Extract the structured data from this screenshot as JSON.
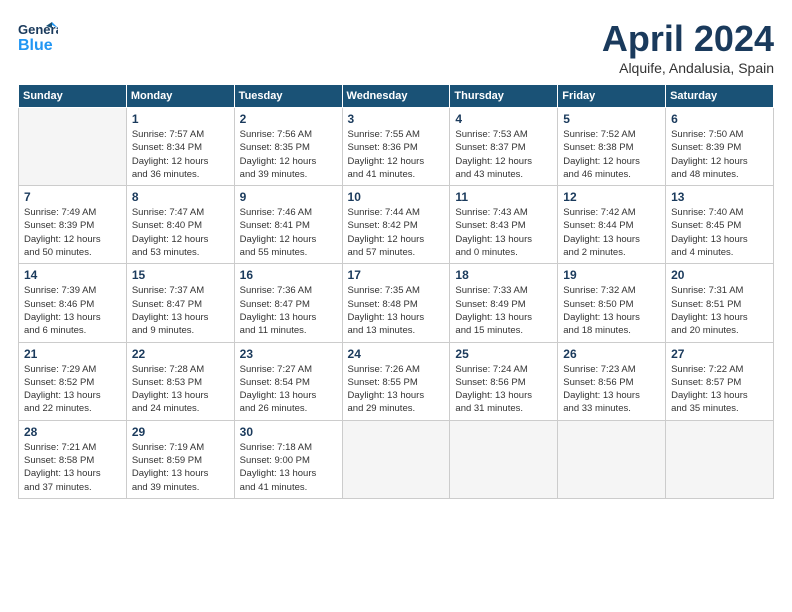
{
  "header": {
    "logo_general": "General",
    "logo_blue": "Blue",
    "title": "April 2024",
    "location": "Alquife, Andalusia, Spain"
  },
  "weekdays": [
    "Sunday",
    "Monday",
    "Tuesday",
    "Wednesday",
    "Thursday",
    "Friday",
    "Saturday"
  ],
  "weeks": [
    [
      {
        "num": "",
        "info": ""
      },
      {
        "num": "1",
        "info": "Sunrise: 7:57 AM\nSunset: 8:34 PM\nDaylight: 12 hours\nand 36 minutes."
      },
      {
        "num": "2",
        "info": "Sunrise: 7:56 AM\nSunset: 8:35 PM\nDaylight: 12 hours\nand 39 minutes."
      },
      {
        "num": "3",
        "info": "Sunrise: 7:55 AM\nSunset: 8:36 PM\nDaylight: 12 hours\nand 41 minutes."
      },
      {
        "num": "4",
        "info": "Sunrise: 7:53 AM\nSunset: 8:37 PM\nDaylight: 12 hours\nand 43 minutes."
      },
      {
        "num": "5",
        "info": "Sunrise: 7:52 AM\nSunset: 8:38 PM\nDaylight: 12 hours\nand 46 minutes."
      },
      {
        "num": "6",
        "info": "Sunrise: 7:50 AM\nSunset: 8:39 PM\nDaylight: 12 hours\nand 48 minutes."
      }
    ],
    [
      {
        "num": "7",
        "info": "Sunrise: 7:49 AM\nSunset: 8:39 PM\nDaylight: 12 hours\nand 50 minutes."
      },
      {
        "num": "8",
        "info": "Sunrise: 7:47 AM\nSunset: 8:40 PM\nDaylight: 12 hours\nand 53 minutes."
      },
      {
        "num": "9",
        "info": "Sunrise: 7:46 AM\nSunset: 8:41 PM\nDaylight: 12 hours\nand 55 minutes."
      },
      {
        "num": "10",
        "info": "Sunrise: 7:44 AM\nSunset: 8:42 PM\nDaylight: 12 hours\nand 57 minutes."
      },
      {
        "num": "11",
        "info": "Sunrise: 7:43 AM\nSunset: 8:43 PM\nDaylight: 13 hours\nand 0 minutes."
      },
      {
        "num": "12",
        "info": "Sunrise: 7:42 AM\nSunset: 8:44 PM\nDaylight: 13 hours\nand 2 minutes."
      },
      {
        "num": "13",
        "info": "Sunrise: 7:40 AM\nSunset: 8:45 PM\nDaylight: 13 hours\nand 4 minutes."
      }
    ],
    [
      {
        "num": "14",
        "info": "Sunrise: 7:39 AM\nSunset: 8:46 PM\nDaylight: 13 hours\nand 6 minutes."
      },
      {
        "num": "15",
        "info": "Sunrise: 7:37 AM\nSunset: 8:47 PM\nDaylight: 13 hours\nand 9 minutes."
      },
      {
        "num": "16",
        "info": "Sunrise: 7:36 AM\nSunset: 8:47 PM\nDaylight: 13 hours\nand 11 minutes."
      },
      {
        "num": "17",
        "info": "Sunrise: 7:35 AM\nSunset: 8:48 PM\nDaylight: 13 hours\nand 13 minutes."
      },
      {
        "num": "18",
        "info": "Sunrise: 7:33 AM\nSunset: 8:49 PM\nDaylight: 13 hours\nand 15 minutes."
      },
      {
        "num": "19",
        "info": "Sunrise: 7:32 AM\nSunset: 8:50 PM\nDaylight: 13 hours\nand 18 minutes."
      },
      {
        "num": "20",
        "info": "Sunrise: 7:31 AM\nSunset: 8:51 PM\nDaylight: 13 hours\nand 20 minutes."
      }
    ],
    [
      {
        "num": "21",
        "info": "Sunrise: 7:29 AM\nSunset: 8:52 PM\nDaylight: 13 hours\nand 22 minutes."
      },
      {
        "num": "22",
        "info": "Sunrise: 7:28 AM\nSunset: 8:53 PM\nDaylight: 13 hours\nand 24 minutes."
      },
      {
        "num": "23",
        "info": "Sunrise: 7:27 AM\nSunset: 8:54 PM\nDaylight: 13 hours\nand 26 minutes."
      },
      {
        "num": "24",
        "info": "Sunrise: 7:26 AM\nSunset: 8:55 PM\nDaylight: 13 hours\nand 29 minutes."
      },
      {
        "num": "25",
        "info": "Sunrise: 7:24 AM\nSunset: 8:56 PM\nDaylight: 13 hours\nand 31 minutes."
      },
      {
        "num": "26",
        "info": "Sunrise: 7:23 AM\nSunset: 8:56 PM\nDaylight: 13 hours\nand 33 minutes."
      },
      {
        "num": "27",
        "info": "Sunrise: 7:22 AM\nSunset: 8:57 PM\nDaylight: 13 hours\nand 35 minutes."
      }
    ],
    [
      {
        "num": "28",
        "info": "Sunrise: 7:21 AM\nSunset: 8:58 PM\nDaylight: 13 hours\nand 37 minutes."
      },
      {
        "num": "29",
        "info": "Sunrise: 7:19 AM\nSunset: 8:59 PM\nDaylight: 13 hours\nand 39 minutes."
      },
      {
        "num": "30",
        "info": "Sunrise: 7:18 AM\nSunset: 9:00 PM\nDaylight: 13 hours\nand 41 minutes."
      },
      {
        "num": "",
        "info": ""
      },
      {
        "num": "",
        "info": ""
      },
      {
        "num": "",
        "info": ""
      },
      {
        "num": "",
        "info": ""
      }
    ]
  ]
}
